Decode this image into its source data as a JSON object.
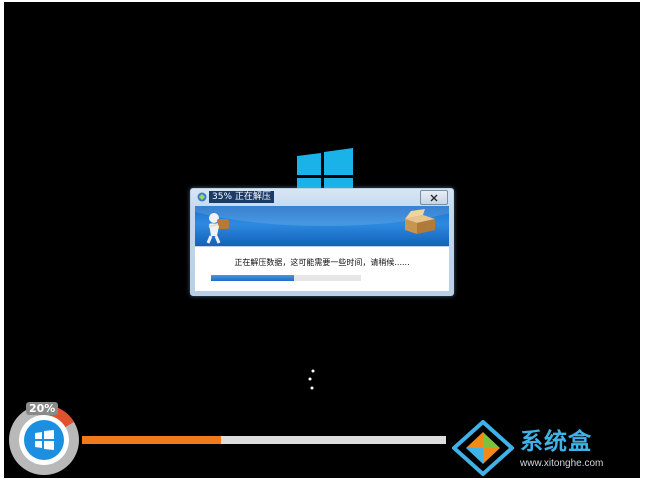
{
  "dialog": {
    "title": "35% 正在解压",
    "message": "正在解压数据，这可能需要一些时间，请稍候......",
    "progress": 0.55
  },
  "installer": {
    "percent_label": "20%",
    "progress": 0.38
  },
  "watermark": {
    "title": "系统盒",
    "url": "www.xitonghe.com"
  },
  "icons": [
    "windows-logo-icon",
    "installer-icon",
    "close-icon",
    "mascot-icon",
    "box-icon",
    "loading-dots-icon",
    "windows-badge-icon",
    "watermark-logo-icon"
  ],
  "colors": {
    "background": "#000000",
    "progress_orange": "#f07b1f",
    "dialog_blue": "#1f6fc9",
    "windows_cyan": "#1ab4ea"
  }
}
